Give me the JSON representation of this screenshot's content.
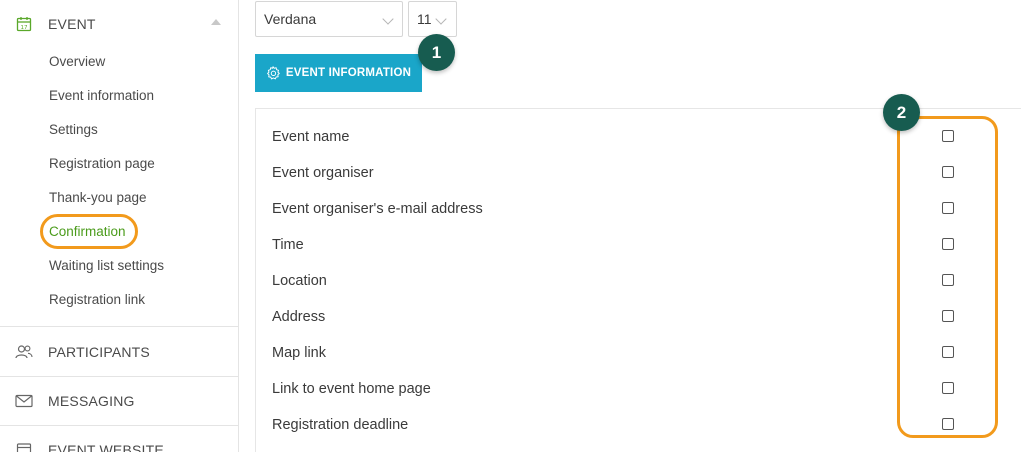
{
  "sidebar": {
    "event": {
      "label": "EVENT",
      "icon": "calendar-icon"
    },
    "items": [
      {
        "label": "Overview"
      },
      {
        "label": "Event information"
      },
      {
        "label": "Settings"
      },
      {
        "label": "Registration page"
      },
      {
        "label": "Thank-you page"
      },
      {
        "label": "Confirmation",
        "active": true
      },
      {
        "label": "Waiting list settings"
      },
      {
        "label": "Registration link"
      }
    ],
    "participants": {
      "label": "PARTICIPANTS",
      "icon": "people-icon"
    },
    "messaging": {
      "label": "MESSAGING",
      "icon": "envelope-icon"
    },
    "website": {
      "label": "EVENT WEBSITE",
      "icon": "window-icon"
    }
  },
  "toolbar": {
    "font_family": "Verdana",
    "font_size": "11"
  },
  "event_info_button": {
    "label": "EVENT INFORMATION",
    "icon": "gear-icon"
  },
  "callouts": {
    "one": "1",
    "two": "2"
  },
  "fields": [
    {
      "label": "Event name",
      "checked": false
    },
    {
      "label": "Event organiser",
      "checked": false
    },
    {
      "label": "Event organiser's e-mail address",
      "checked": false
    },
    {
      "label": "Time",
      "checked": false
    },
    {
      "label": "Location",
      "checked": false
    },
    {
      "label": "Address",
      "checked": false
    },
    {
      "label": "Map link",
      "checked": false
    },
    {
      "label": "Link to event home page",
      "checked": false
    },
    {
      "label": "Registration deadline",
      "checked": false
    }
  ],
  "colors": {
    "accent_green": "#4a9b1a",
    "button_blue": "#1aa6c9",
    "badge_teal": "#175c50",
    "highlight_orange": "#f29a1c"
  }
}
